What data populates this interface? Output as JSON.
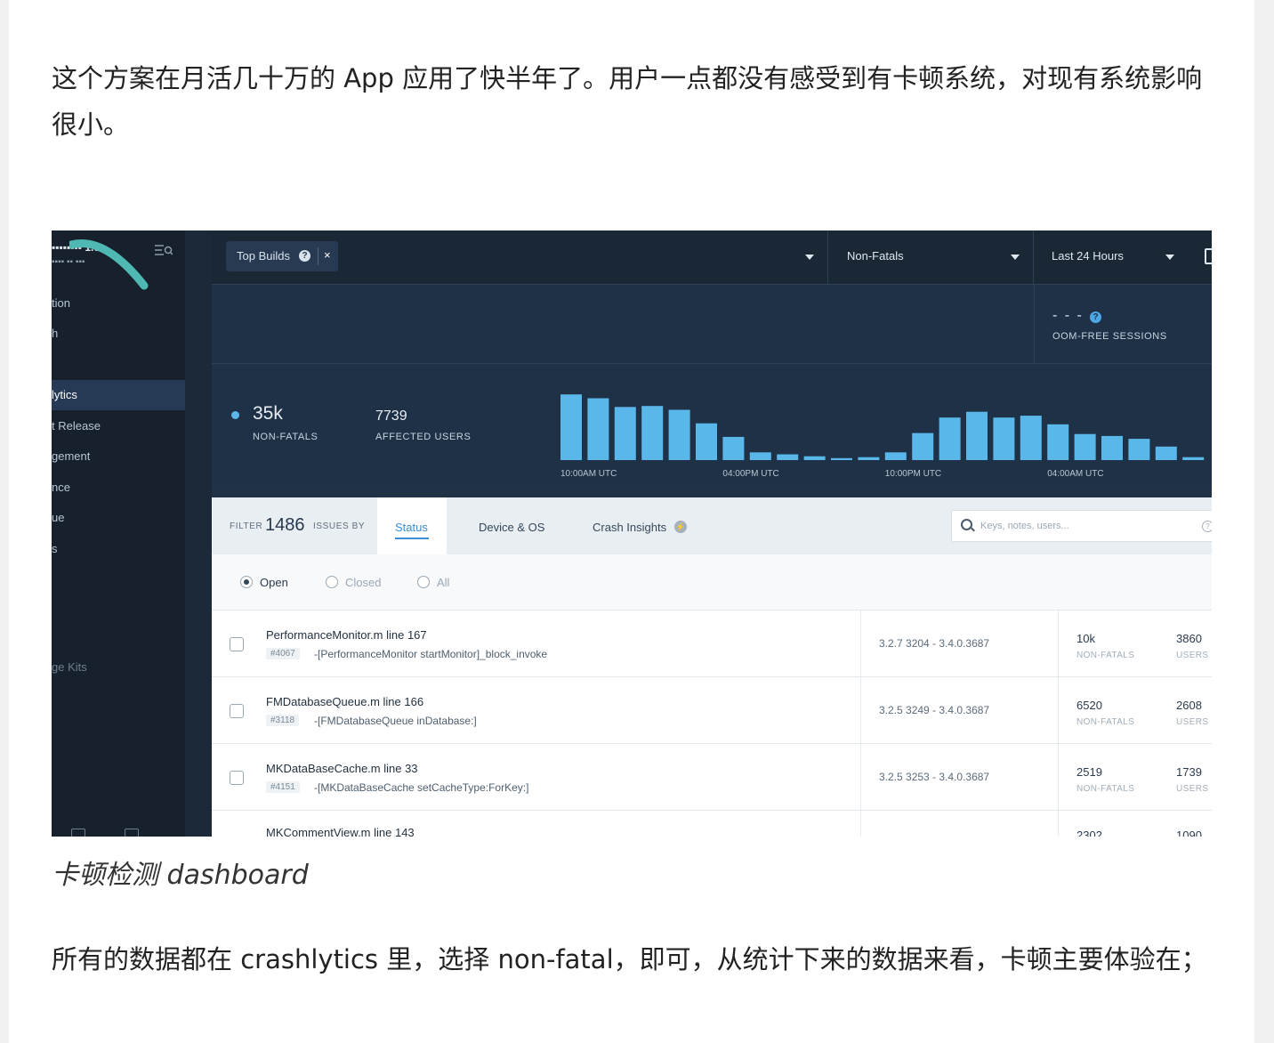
{
  "article": {
    "paragraph_top": "这个方案在月活几十万的 App 应用了快半年了。用户一点都没有感受到有卡顿系统，对现有系统影响很小。",
    "caption": "卡顿检测 dashboard",
    "paragraph_bottom": "所有的数据都在 crashlytics 里，选择 non-fatal，即可，从统计下来的数据来看，卡顿主要体验在；"
  },
  "dashboard": {
    "colors": {
      "sidebar": "#16212d",
      "header": "#1a2836",
      "band": "#1f3146",
      "bar": "#5ab7ea",
      "accent": "#3b8fd6"
    },
    "sidebar": {
      "items": [
        {
          "label": "tion",
          "active": false
        },
        {
          "label": "h",
          "active": false
        },
        {
          "label": "lytics",
          "active": true
        },
        {
          "label": "t Release",
          "active": false
        },
        {
          "label": "gement",
          "active": false
        },
        {
          "label": "nce",
          "active": false
        },
        {
          "label": "ue",
          "active": false
        },
        {
          "label": "s",
          "active": false
        },
        {
          "label": "ge Kits",
          "active": false
        }
      ]
    },
    "topbar": {
      "filter_chip": "Top Builds",
      "chip_close": "×",
      "event_type": "Non-Fatals",
      "time_range": "Last 24 Hours"
    },
    "oom": {
      "value": "- - -",
      "help": "?",
      "label": "OOM-FREE SESSIONS"
    },
    "summary": {
      "non_fatals_value": "35k",
      "non_fatals_label": "NON-FATALS",
      "affected_users_value": "7739",
      "affected_users_label": "AFFECTED USERS"
    },
    "chart_data": {
      "type": "bar",
      "title": "",
      "xlabel": "",
      "ylabel": "",
      "tick_labels": [
        "10:00AM UTC",
        "04:00PM UTC",
        "10:00PM UTC",
        "04:00AM UTC"
      ],
      "tick_bar_index": [
        0,
        6,
        12,
        18
      ],
      "values": [
        68,
        64,
        55,
        56,
        52,
        38,
        24,
        8,
        6,
        4,
        2,
        3,
        8,
        28,
        44,
        50,
        44,
        46,
        37,
        27,
        25,
        22,
        14,
        3
      ],
      "ylim": [
        0,
        70
      ]
    },
    "filter": {
      "filter_word": "FILTER",
      "count": "1486",
      "by_word": "ISSUES BY",
      "tabs": [
        "Status",
        "Device & OS",
        "Crash Insights"
      ],
      "search_placeholder": "Keys, notes, users..."
    },
    "status_options": [
      "Open",
      "Closed",
      "All"
    ],
    "issues": [
      {
        "file": "PerformanceMonitor.m line 167",
        "id": "#4067",
        "method": "-[PerformanceMonitor startMonitor]_block_invoke",
        "versions": "3.2.7 3204 - 3.4.0.3687",
        "non_fatals": "10k",
        "users": "3860"
      },
      {
        "file": "FMDatabaseQueue.m line 166",
        "id": "#3118",
        "method": "-[FMDatabaseQueue inDatabase:]",
        "versions": "3.2.5 3249 - 3.4.0.3687",
        "non_fatals": "6520",
        "users": "2608"
      },
      {
        "file": "MKDataBaseCache.m line 33",
        "id": "#4151",
        "method": "-[MKDataBaseCache setCacheType:ForKey:]",
        "versions": "3.2.5 3253 - 3.4.0.3687",
        "non_fatals": "2519",
        "users": "1739"
      },
      {
        "file": "MKCommentView.m line 143",
        "id": "",
        "method": "",
        "versions": "",
        "non_fatals": "2302",
        "users": "1090"
      }
    ],
    "nf_label": "NON-FATALS",
    "users_label": "USERS"
  }
}
